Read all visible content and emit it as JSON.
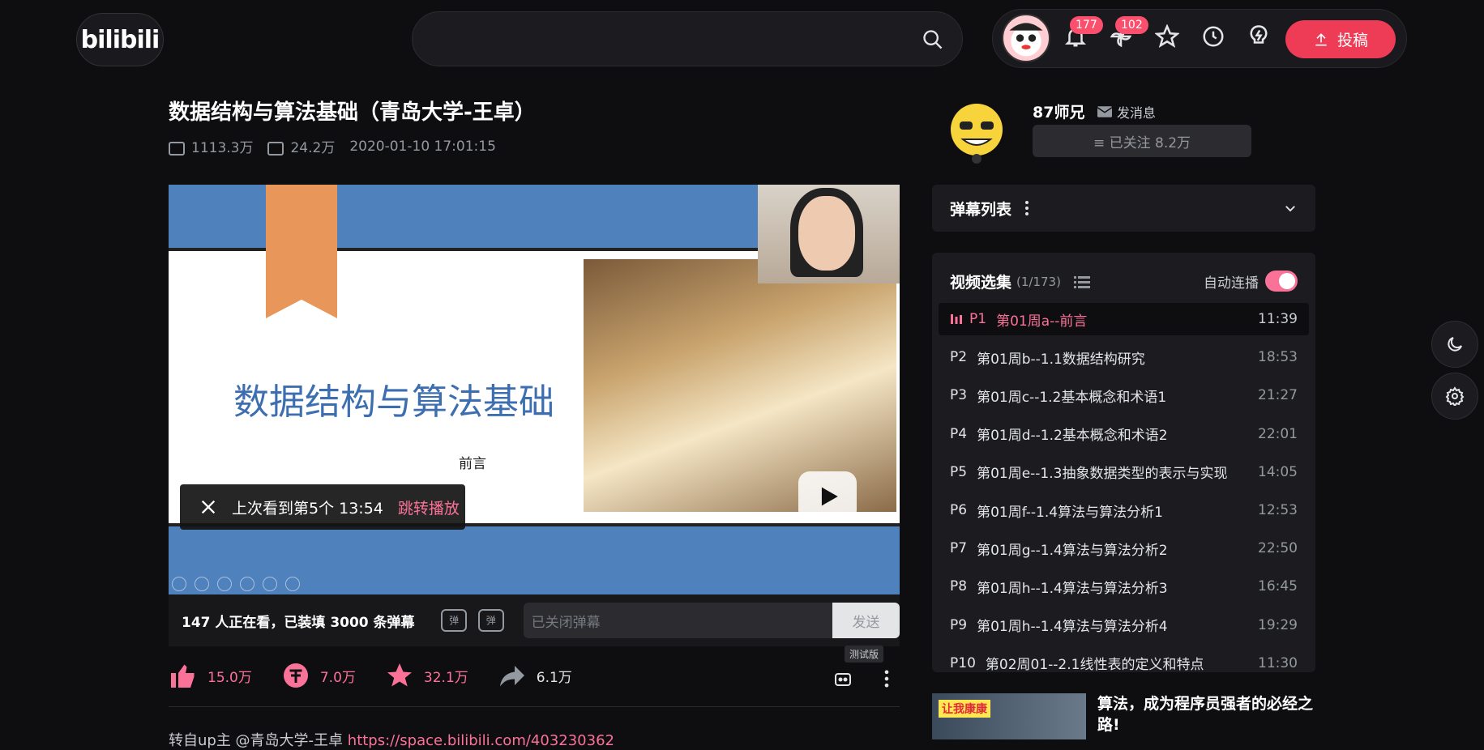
{
  "header": {
    "logo": "bilibili",
    "search_placeholder": "",
    "notifications_badge": "177",
    "dynamics_badge": "102",
    "upload_label": "投稿"
  },
  "video": {
    "title": "数据结构与算法基础（青岛大学-王卓）",
    "views": "1113.3万",
    "danmaku_count": "24.2万",
    "date": "2020-01-10 17:01:15",
    "slide_title": "数据结构与算法基础",
    "slide_subtitle": "前言",
    "resume_text": "上次看到第5个 13:54",
    "resume_jump": "跳转播放"
  },
  "danmaku_bar": {
    "watching": "147 人正在看，已装填 3000 条弹幕",
    "input_placeholder": "已关闭弹幕",
    "send_label": "发送",
    "test_tag": "测试版"
  },
  "actions": {
    "like": "15.0万",
    "coin": "7.0万",
    "favorite": "32.1万",
    "share": "6.1万"
  },
  "description": {
    "prefix": "转自up主 @青岛大学-王卓 ",
    "link": "https://space.bilibili.com/403230362"
  },
  "uploader": {
    "name": "87师兄",
    "message_label": "发消息",
    "follow_label": "≡ 已关注 8.2万"
  },
  "danmaku_list": {
    "label": "弹幕列表"
  },
  "playlist": {
    "title": "视频选集",
    "count": "(1/173)",
    "autoplay_label": "自动连播",
    "episodes": [
      {
        "p": "P1",
        "title": "第01周a--前言",
        "duration": "11:39"
      },
      {
        "p": "P2",
        "title": "第01周b--1.1数据结构研究",
        "duration": "18:53"
      },
      {
        "p": "P3",
        "title": "第01周c--1.2基本概念和术语1",
        "duration": "21:27"
      },
      {
        "p": "P4",
        "title": "第01周d--1.2基本概念和术语2",
        "duration": "22:01"
      },
      {
        "p": "P5",
        "title": "第01周e--1.3抽象数据类型的表示与实现",
        "duration": "14:05"
      },
      {
        "p": "P6",
        "title": "第01周f--1.4算法与算法分析1",
        "duration": "12:53"
      },
      {
        "p": "P7",
        "title": "第01周g--1.4算法与算法分析2",
        "duration": "22:50"
      },
      {
        "p": "P8",
        "title": "第01周h--1.4算法与算法分析3",
        "duration": "16:45"
      },
      {
        "p": "P9",
        "title": "第01周h--1.4算法与算法分析4",
        "duration": "19:29"
      },
      {
        "p": "P10",
        "title": "第02周01--2.1线性表的定义和特点",
        "duration": "11:30"
      }
    ]
  },
  "recommendation": {
    "thumb_tag": "让我康康",
    "title": "算法，成为程序员强者的必经之路!"
  },
  "colors": {
    "accent": "#fb7299",
    "upload_bg": "#ee3c56",
    "bg": "#0e0e11"
  }
}
